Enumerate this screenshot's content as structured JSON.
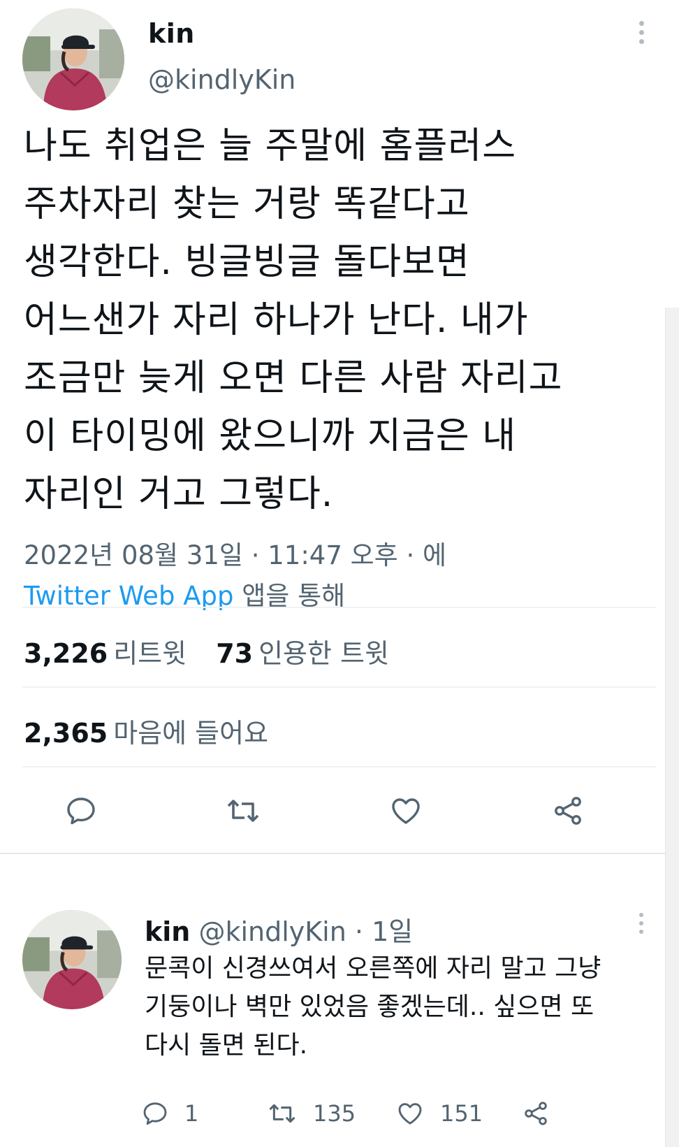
{
  "main_tweet": {
    "author_name": "kin",
    "author_handle": "@kindlyKin",
    "text_lines": [
      "나도 취업은 늘 주말에 홈플러스",
      "주차자리 찾는 거랑 똑같다고",
      "생각한다. 빙글빙글 돌다보면",
      "어느샌가 자리 하나가 난다. 내가",
      "조금만 늦게 오면 다른 사람 자리고",
      "이 타이밍에 왔으니까 지금은 내",
      "자리인 거고 그렇다."
    ],
    "timestamp": "2022년 08월 31일 · 11:47 오후 · 에",
    "source_app": "Twitter Web App",
    "source_suffix": "앱을 통해",
    "retweets_count": "3,226",
    "retweets_label": "리트윗",
    "quotes_count": "73",
    "quotes_label": "인용한 트윗",
    "likes_count": "2,365",
    "likes_label": "마음에 들어요"
  },
  "reply": {
    "author_name": "kin",
    "author_handle": "@kindlyKin",
    "separator": "·",
    "time": "1일",
    "text_lines": [
      "문콕이 신경쓰여서 오른쪽에 자리 말고 그냥",
      "기둥이나 벽만 있었음 좋겠는데.. 싶으면 또",
      "다시 돌면 된다."
    ],
    "reply_count": "1",
    "retweet_count": "135",
    "like_count": "151"
  },
  "colors": {
    "text": "#0f1419",
    "secondary": "#536471",
    "accent": "#1d9bf0",
    "divider": "#eff3f4"
  },
  "icons": [
    "more-vertical-icon",
    "reply-icon",
    "retweet-icon",
    "like-icon",
    "share-icon"
  ]
}
